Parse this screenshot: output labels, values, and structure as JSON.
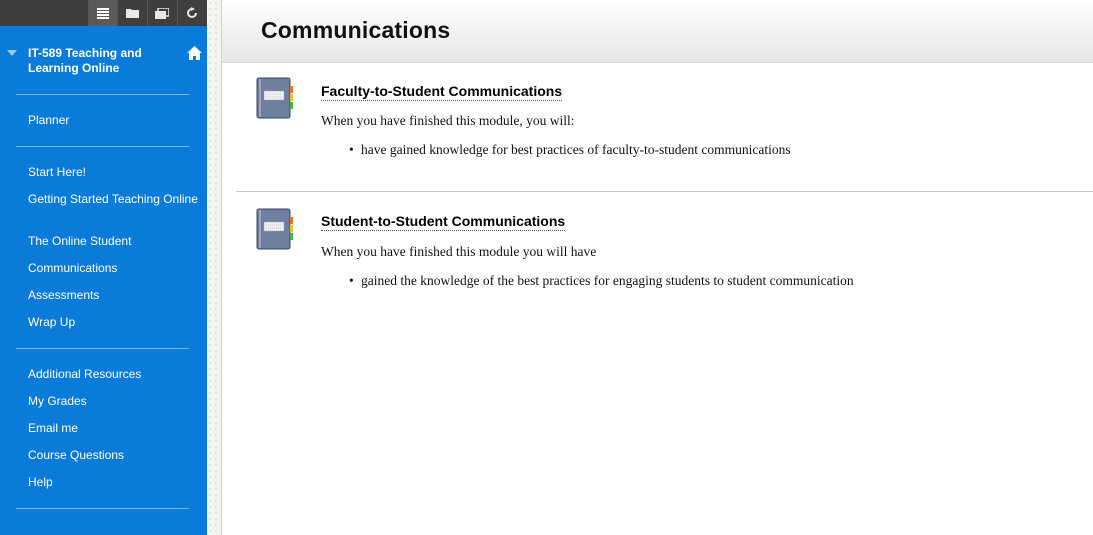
{
  "toolbar": {
    "icons": [
      "menu-list-icon",
      "folder-icon",
      "window-icon",
      "refresh-icon"
    ]
  },
  "sidebar": {
    "course_title": "IT-589 Teaching and Learning Online",
    "items": [
      {
        "label": "Planner"
      },
      {
        "label": "Start Here!"
      },
      {
        "label": "Getting Started Teaching Online"
      },
      {
        "label": "The Online Student"
      },
      {
        "label": "Communications"
      },
      {
        "label": "Assessments"
      },
      {
        "label": "Wrap Up"
      },
      {
        "label": "Additional Resources"
      },
      {
        "label": "My Grades"
      },
      {
        "label": "Email me"
      },
      {
        "label": "Course Questions"
      },
      {
        "label": "Help"
      }
    ]
  },
  "page": {
    "title": "Communications"
  },
  "modules": [
    {
      "title": "Faculty-to-Student Communications",
      "description": "When you have finished this module, you will:",
      "bullets": [
        "have gained knowledge for best practices of faculty-to-student communications"
      ]
    },
    {
      "title": "Student-to-Student Communications",
      "description": "When you have finished this module you will have",
      "bullets": [
        "gained the knowledge of the best practices for engaging students to student communication"
      ]
    }
  ],
  "colors": {
    "sidebar_bg": "#0a7bd8",
    "toolbar_bg": "#3f3f3f",
    "header_gradient_end": "#e6e6e6"
  }
}
